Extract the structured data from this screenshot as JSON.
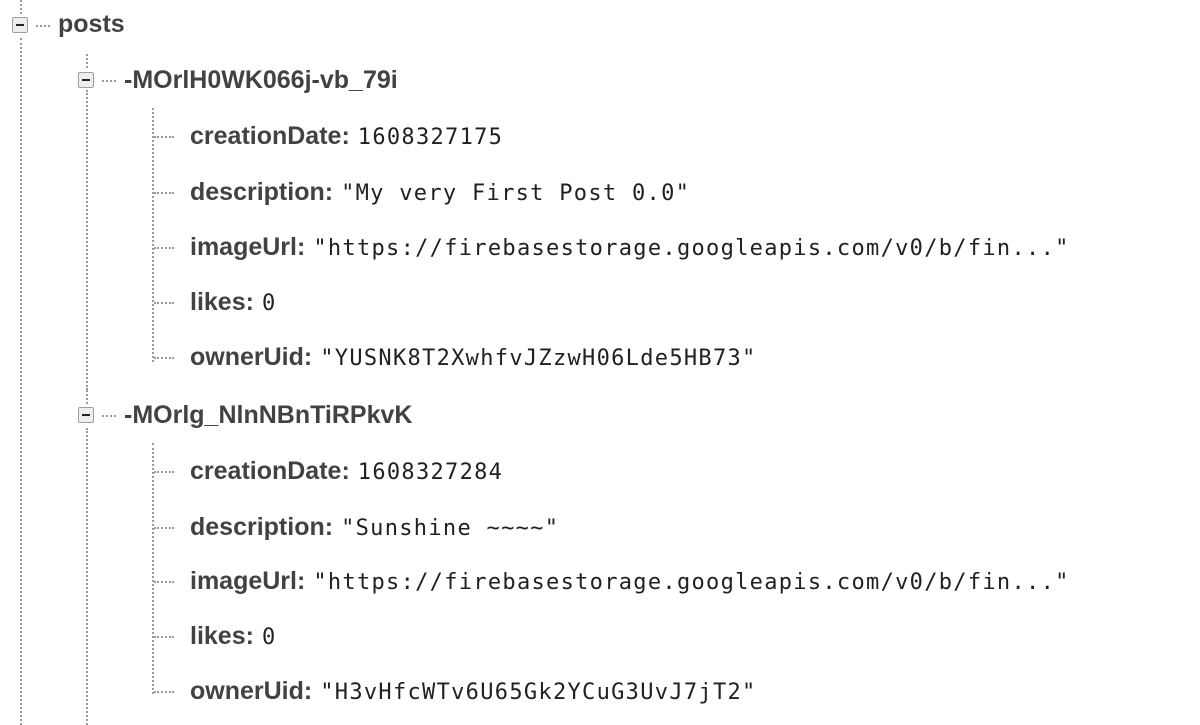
{
  "root": {
    "label": "posts"
  },
  "posts": [
    {
      "key": "-MOrlH0WK066j-vb_79i",
      "fields": [
        {
          "key": "creationDate",
          "value": "1608327175"
        },
        {
          "key": "description",
          "value": "\"My very First Post 0.0\""
        },
        {
          "key": "imageUrl",
          "value": "\"https://firebasestorage.googleapis.com/v0/b/fin...\""
        },
        {
          "key": "likes",
          "value": "0"
        },
        {
          "key": "ownerUid",
          "value": "\"YUSNK8T2XwhfvJZzwH06Lde5HB73\""
        }
      ]
    },
    {
      "key": "-MOrlg_NlnNBnTiRPkvK",
      "fields": [
        {
          "key": "creationDate",
          "value": "1608327284"
        },
        {
          "key": "description",
          "value": "\"Sunshine ~~~~\""
        },
        {
          "key": "imageUrl",
          "value": "\"https://firebasestorage.googleapis.com/v0/b/fin...\""
        },
        {
          "key": "likes",
          "value": "0"
        },
        {
          "key": "ownerUid",
          "value": "\"H3vHfcWTv6U65Gk2YCuG3UvJ7jT2\""
        }
      ]
    }
  ],
  "icons": {
    "collapse": "collapse-minus-icon"
  },
  "colors": {
    "text": "#424242",
    "value": "#202124",
    "tree_line": "#9a9a9a"
  }
}
